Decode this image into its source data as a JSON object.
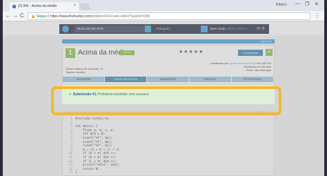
{
  "browser": {
    "tab_title": "(2) 941 - Acima da média",
    "tab_close": "×",
    "user": "Ribeiro",
    "win_min": "—",
    "win_max": "❐",
    "win_close": "✕",
    "back": "←",
    "forward": "→",
    "reload": "C",
    "secure_label": "Seguro",
    "url_host": "https://www.thehuxley.com",
    "url_path": "/problem/941/code-editor?quizId=1009",
    "menu": "⋮"
  },
  "site": {
    "search_placeholder": "BUSCAR NO SITE",
    "language": "Português",
    "welcome": "Bem-vindo,",
    "username": "Ribeiro Ribeiro",
    "icons": "✉ ⚙"
  },
  "problem": {
    "strip_label": "Algoritmo",
    "number": "1",
    "title": "Acima da média",
    "level": "FÁCIL",
    "stars": "★★★★★",
    "share": "Compartilhar",
    "check": "✔",
    "exec_time": "Tempo máximo de execução: 1s",
    "tries": "Tópicos: decisão",
    "registered": "Cadastrado por:",
    "author": "gestão docente huxley",
    "date": "em 23/07/16",
    "updated": "Atualizado em seis dias",
    "reported": "Fonte: não informada",
    "tabs": [
      "DESCRIÇÃO",
      "ENVIAR RESPOSTA",
      "SUBMISSÕES",
      "ORÁCULO",
      "ESTATÍSTICAS"
    ],
    "active_tab_index": 1
  },
  "alert": {
    "label": "Submissão #1:",
    "message": "Problema resolvido com sucesso"
  },
  "editor": {
    "bar_label": "C",
    "lines": [
      "#include <stdio.h>",
      "",
      "int main() {",
      "    float a, b, c, m;",
      "    int qtd = 0;",
      "    scanf(\"%f\", &a);",
      "    scanf(\"%f\", &b);",
      "    scanf(\"%f\", &c);",
      "    m = (a + b + c) / 3;",
      "    if (a > m) qtd ++;",
      "    if (b > m) qtd ++;",
      "    if (c > m) qtd ++;",
      "    printf(\"%d\\n\", qtd);",
      "    return 0;",
      "}"
    ],
    "line_numbers": [
      "1",
      "2",
      "3",
      "4",
      "5",
      "6",
      "7",
      "8",
      "9",
      "10",
      "11",
      "12",
      "13",
      "14",
      "15"
    ]
  },
  "colors": {
    "highlight": "#f5b82e",
    "success_bg": "#dff0d8",
    "accent": "#4aa3df",
    "level_green": "#8bc34a"
  }
}
